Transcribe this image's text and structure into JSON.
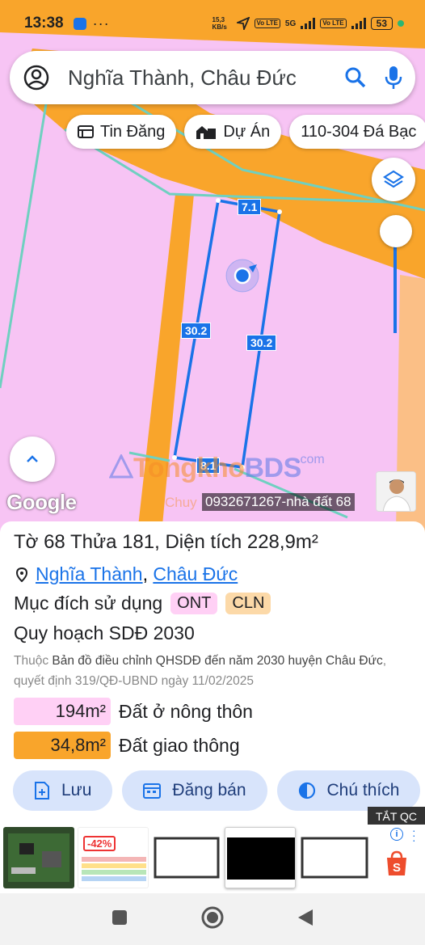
{
  "status_bar": {
    "time": "13:38",
    "net_speed": "15,3 KB/s",
    "lte_label": "Vo LTE",
    "five_g": "5G",
    "battery": "53"
  },
  "search": {
    "query": "Nghĩa Thành, Châu Đức"
  },
  "chips": [
    {
      "label": "Tin Đăng",
      "icon": "news-icon"
    },
    {
      "label": "Dự Án",
      "icon": "building-icon"
    },
    {
      "label": "110-304 Đá Bạc",
      "icon": ""
    }
  ],
  "map": {
    "edge_labels": [
      "7.1",
      "30.2",
      "30.2",
      "8.1"
    ],
    "google_label": "Google",
    "watermark_main": "Tongkho",
    "watermark_bds": "BDS",
    "watermark_com": ".com",
    "watermark_sub": "Chuy",
    "phone_label": "0932671267-nhà đất 68"
  },
  "info": {
    "title": "Tờ 68 Thửa 181, Diện tích 228,9m²",
    "location_commune": "Nghĩa Thành",
    "location_sep": ",",
    "location_district": "Châu Đức",
    "purpose_label": "Mục đích sử dụng",
    "purpose_tags": [
      "ONT",
      "CLN"
    ],
    "plan_title": "Quy hoạch SDĐ 2030",
    "desc_prefix": "Thuộc",
    "desc_main": "Bản đồ điều chỉnh QHSDĐ đến năm 2030 huyện Châu Đức",
    "desc_suffix": ", quyết định 319/QĐ-UBND ngày 11/02/2025",
    "areas": [
      {
        "value": "194m²",
        "label": "Đất ở nông thôn",
        "color": "#ffd0f5"
      },
      {
        "value": "34,8m²",
        "label": "Đất giao thông",
        "color": "#f9a52b"
      }
    ]
  },
  "actions": [
    {
      "label": "Lưu",
      "icon": "add-file-icon"
    },
    {
      "label": "Đăng bán",
      "icon": "calendar-icon"
    },
    {
      "label": "Chú thích",
      "icon": "contrast-icon"
    }
  ],
  "ad": {
    "close_label": "TẮT QC",
    "discount": "-42%"
  },
  "colors": {
    "map_pink": "#f7c4f4",
    "road_orange": "#f9a52b",
    "parcel_blue": "#1a73e8",
    "action_bg": "#d8e4fb"
  }
}
